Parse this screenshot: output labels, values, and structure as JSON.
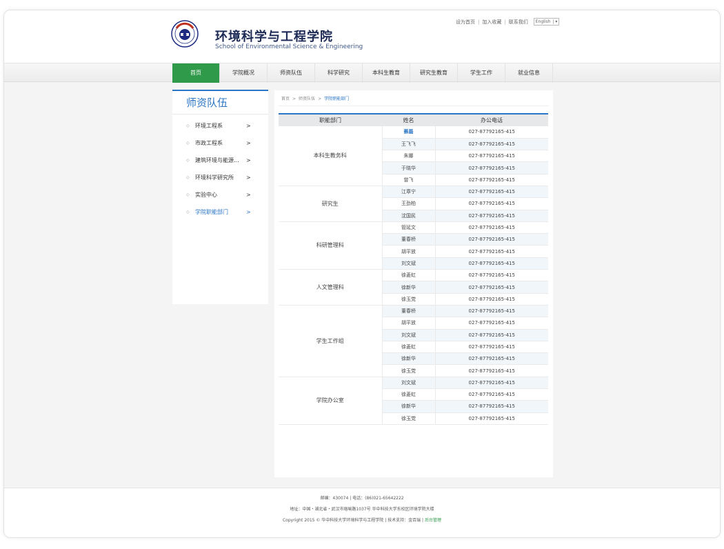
{
  "header": {
    "title_cn": "环境科学与工程学院",
    "title_en": "School of Environmental Science & Engineering",
    "top_links": [
      "设为首页",
      "加入收藏",
      "联系我们"
    ],
    "language": "English"
  },
  "nav": {
    "items": [
      {
        "label": "首页",
        "active": true
      },
      {
        "label": "学院概况"
      },
      {
        "label": "师资队伍"
      },
      {
        "label": "科学研究"
      },
      {
        "label": "本科生教育"
      },
      {
        "label": "研究生教育"
      },
      {
        "label": "学生工作"
      },
      {
        "label": "就业信息"
      }
    ]
  },
  "sidebar": {
    "title": "师资队伍",
    "items": [
      {
        "label": "环境工程系"
      },
      {
        "label": "市政工程系"
      },
      {
        "label": "建筑环境与能源..."
      },
      {
        "label": "环境科学研究所"
      },
      {
        "label": "实验中心"
      },
      {
        "label": "学院职能部门",
        "active": true
      }
    ],
    "arrow": ">",
    "bullet": "◇"
  },
  "breadcrumb": {
    "home": "首页",
    "section": "师资队伍",
    "current": "学院职能部门",
    "separator": ">"
  },
  "table": {
    "headers": [
      "职能部门",
      "姓名",
      "办公电话"
    ],
    "phone": "027-87792165-415",
    "groups": [
      {
        "dept": "本科生教务科",
        "names": [
          "蔡磊",
          "王飞飞",
          "朱娜",
          "于晓华",
          "曾飞"
        ]
      },
      {
        "dept": "研究生",
        "names": [
          "江章宁",
          "王劲柏",
          "沈国民"
        ]
      },
      {
        "dept": "科研管理科",
        "names": [
          "管延文",
          "董春桥",
          "胡平放",
          "刘文斌"
        ]
      },
      {
        "dept": "人文管理科",
        "names": [
          "徐菱虹",
          "徐新华",
          "徐玉党"
        ]
      },
      {
        "dept": "学生工作组",
        "names": [
          "董春桥",
          "胡平放",
          "刘文斌",
          "徐菱虹",
          "徐新华",
          "徐玉党"
        ]
      },
      {
        "dept": "学院办公室",
        "names": [
          "刘文斌",
          "徐菱虹",
          "徐新华",
          "徐玉党"
        ]
      }
    ]
  },
  "footer": {
    "line1": "邮编：430074 | 电话：(86)021-65642222",
    "line2": "地址：中国・湖北省・武汉市珞喻路1037号 华中科技大学东校区环境学院大楼",
    "line3": "Copyright 2015 © 华中科技大学环境科学与工程学院 | 技术支持：金百瑞 |",
    "admin": "后台管理"
  },
  "colors": {
    "accent_blue": "#2a75c5",
    "nav_active_green": "#2e9a4a"
  }
}
